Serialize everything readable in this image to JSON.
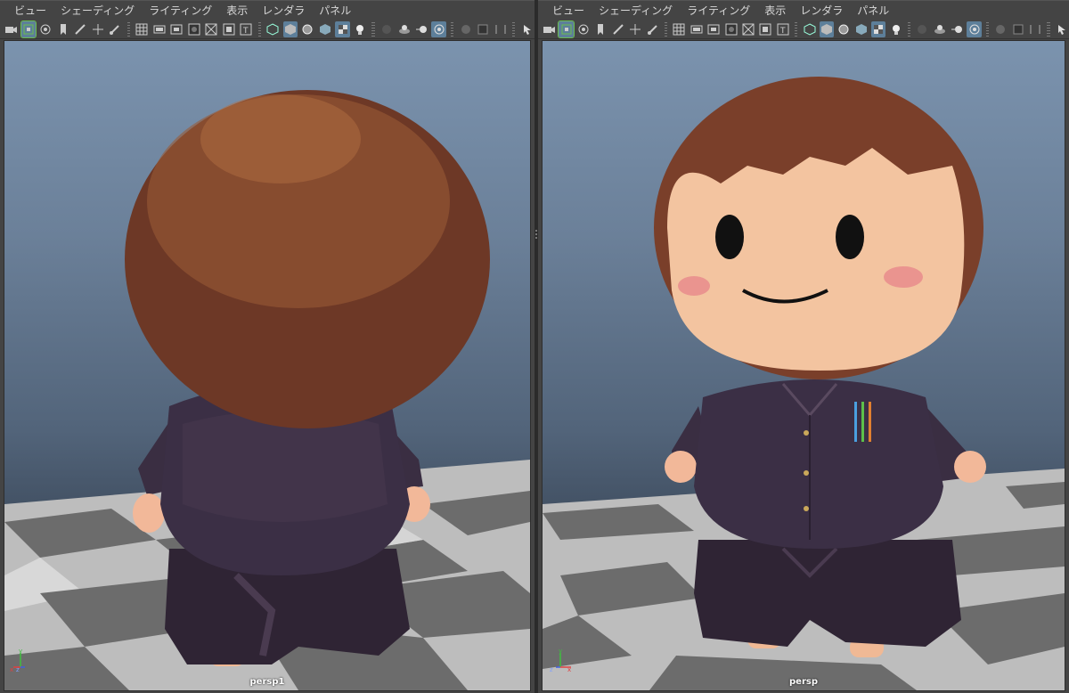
{
  "menus": [
    "ビュー",
    "シェーディング",
    "ライティング",
    "表示",
    "レンダラ",
    "パネル"
  ],
  "toolbar_icons": [
    "camera-icon",
    "camera-lock-icon",
    "camera-attr-icon",
    "bookmark-icon",
    "pencil-icon",
    "move-icon",
    "brush-icon",
    "grid-icon",
    "film-gate-icon",
    "resolution-gate-icon",
    "gate-mask-icon",
    "field-chart-icon",
    "safe-action-icon",
    "safe-title-icon",
    "wireframe-icon",
    "smooth-shade-icon",
    "wire-on-shaded-icon",
    "default-material-icon",
    "textured-icon",
    "use-lights-icon",
    "shadows-icon",
    "screen-space-ao-icon",
    "motion-blur-icon",
    "anti-alias-icon",
    "depth-of-field-icon",
    "isolate-select-icon",
    "xray-icon",
    "select-icon"
  ],
  "colors": {
    "hair": "#7a3f2a",
    "skin": "#f3c4a0",
    "suit": "#3d3040",
    "blush": "#e88c8c",
    "floor_light": "#d0d0d0",
    "floor_dark": "#6e6e6e",
    "active_icon": "#5d7f9a"
  },
  "viewports": [
    {
      "camera": "persp1",
      "view": "back"
    },
    {
      "camera": "persp",
      "view": "front"
    }
  ],
  "axis_labels": {
    "x": "x",
    "y": "y",
    "z": "z"
  }
}
